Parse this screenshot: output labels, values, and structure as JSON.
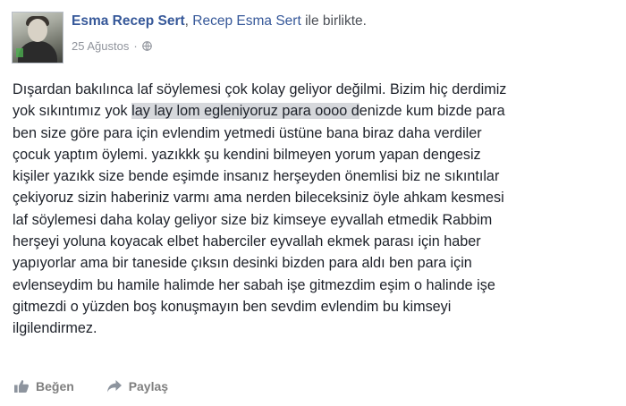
{
  "post": {
    "author": "Esma Recep Sert",
    "separator": ",",
    "with_name": "Recep Esma Sert",
    "with_suffix": "ile birlikte.",
    "date": "25 Ağustos",
    "dot": "·",
    "privacy_icon": "globe-icon",
    "lines": [
      {
        "pre": "Dışardan bakılınca laf söylemesi çok kolay geliyor değilmi. Bizim hiç derdimiz",
        "hl": "",
        "post": ""
      },
      {
        "pre": "yok sıkıntımız yok ",
        "hl": "lay lay lom egleniyoruz para oooo d",
        "post": "enizde kum bizde para"
      },
      {
        "pre": "ben size göre para için evlendim yetmedi üstüne bana biraz daha verdiler",
        "hl": "",
        "post": ""
      },
      {
        "pre": "çocuk yaptım öylemi. yazıkkk şu kendini bilmeyen yorum yapan dengesiz",
        "hl": "",
        "post": ""
      },
      {
        "pre": "kişiler yazıkk size bende eşimde insanız herşeyden önemlisi biz ne sıkıntılar",
        "hl": "",
        "post": ""
      },
      {
        "pre": "çekiyoruz sizin haberiniz varmı ama nerden bileceksiniz öyle ahkam kesmesi",
        "hl": "",
        "post": ""
      },
      {
        "pre": "laf söylemesi daha kolay geliyor size biz kimseye eyvallah etmedik Rabbim",
        "hl": "",
        "post": ""
      },
      {
        "pre": "herşeyi yoluna koyacak elbet haberciler eyvallah ekmek parası için haber",
        "hl": "",
        "post": ""
      },
      {
        "pre": "yapıyorlar ama bir taneside çıksın desinki bizden para aldı ben para için",
        "hl": "",
        "post": ""
      },
      {
        "pre": "evlenseydim bu hamile halimde her sabah işe gitmezdim eşim o halinde işe",
        "hl": "",
        "post": ""
      },
      {
        "pre": "gitmezdi o yüzden boş konuşmayın ben sevdim evlendim bu kimseyi",
        "hl": "",
        "post": ""
      },
      {
        "pre": "ilgilendirmez.",
        "hl": "",
        "post": ""
      }
    ]
  },
  "actions": {
    "like_label": "Beğen",
    "like_icon": "thumbs-up-icon",
    "share_label": "Paylaş",
    "share_icon": "share-arrow-icon"
  },
  "colors": {
    "link": "#365899",
    "meta": "#90949c",
    "highlight": "#d6d8dc"
  }
}
